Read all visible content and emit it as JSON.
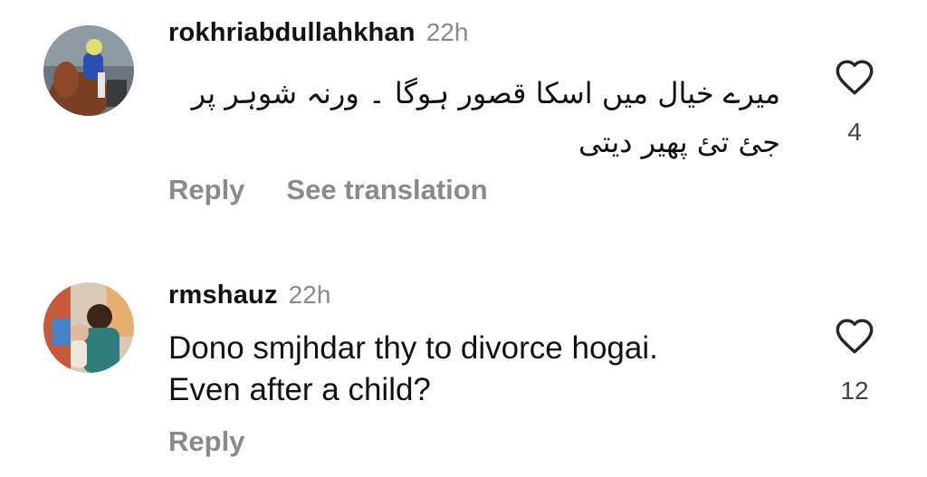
{
  "comments": [
    {
      "username": "rokhriabdullahkhan",
      "time": "22h",
      "text": "میرے خیال میں اسکا قصور ہوگا ۔ ورنہ شوہر پر جئ تئ پھیر دیتی",
      "like_count": "4",
      "reply_label": "Reply",
      "translate_label": "See translation",
      "avatar_icon": "avatar-jockey-horse"
    },
    {
      "username": "rmshauz",
      "time": "22h",
      "text_line1": "Dono smjhdar thy to divorce hogai.",
      "text_line2": "Even after a child?",
      "like_count": "12",
      "reply_label": "Reply",
      "avatar_icon": "avatar-woman-child"
    }
  ],
  "icons": {
    "like": "heart-outline-icon"
  },
  "colors": {
    "username": "#111111",
    "secondary": "#8a8a8a",
    "count": "#444444"
  }
}
